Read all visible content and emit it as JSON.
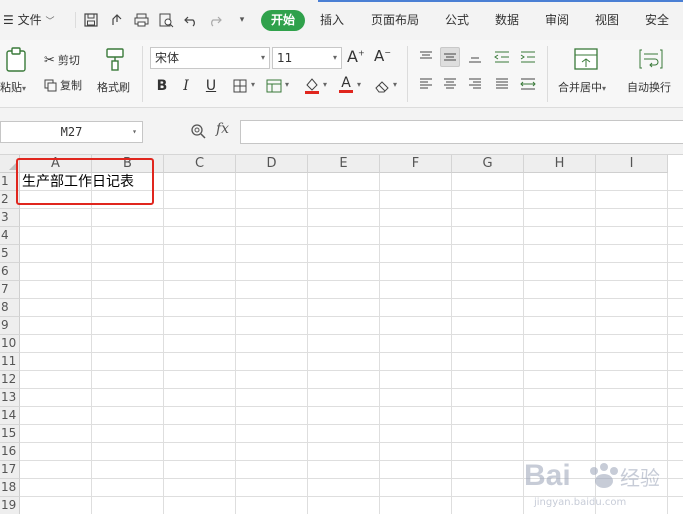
{
  "menubar": {
    "file_label": "文件",
    "tabs": [
      {
        "label": "开始"
      },
      {
        "label": "插入"
      },
      {
        "label": "页面布局"
      },
      {
        "label": "公式"
      },
      {
        "label": "数据"
      },
      {
        "label": "审阅"
      },
      {
        "label": "视图"
      },
      {
        "label": "安全"
      }
    ]
  },
  "ribbon": {
    "paste_label": "粘贴",
    "cut_label": "剪切",
    "copy_label": "复制",
    "format_painter_label": "格式刷",
    "font_name": "宋体",
    "font_size": "11",
    "grow_font_label": "A",
    "shrink_font_label": "A",
    "bold_label": "B",
    "italic_label": "I",
    "underline_label": "U",
    "font_color_label": "A",
    "merge_center_label": "合并居中",
    "wrap_text_label": "自动换行",
    "font_color_hex": "#e0261e",
    "fill_color_hex": "#e0261e"
  },
  "formula_bar": {
    "name_box_value": "M27",
    "fx_label": "fx",
    "formula_value": ""
  },
  "grid": {
    "columns": [
      "A",
      "B",
      "C",
      "D",
      "E",
      "F",
      "G",
      "H",
      "I"
    ],
    "rows": [
      "1",
      "2",
      "3",
      "4",
      "5",
      "6",
      "7",
      "8",
      "9",
      "10",
      "11",
      "12",
      "13",
      "14",
      "15",
      "16",
      "17",
      "18",
      "19"
    ],
    "cell_a1": "生产部工作日记表",
    "highlight_color": "#e0261e"
  },
  "watermark": {
    "brand": "Bai",
    "brand_suffix": "经验",
    "url": "jingyan.baidu.com"
  },
  "colors": {
    "accent_green": "#2fa14b",
    "tab_line_blue": "#4a7fd4"
  }
}
